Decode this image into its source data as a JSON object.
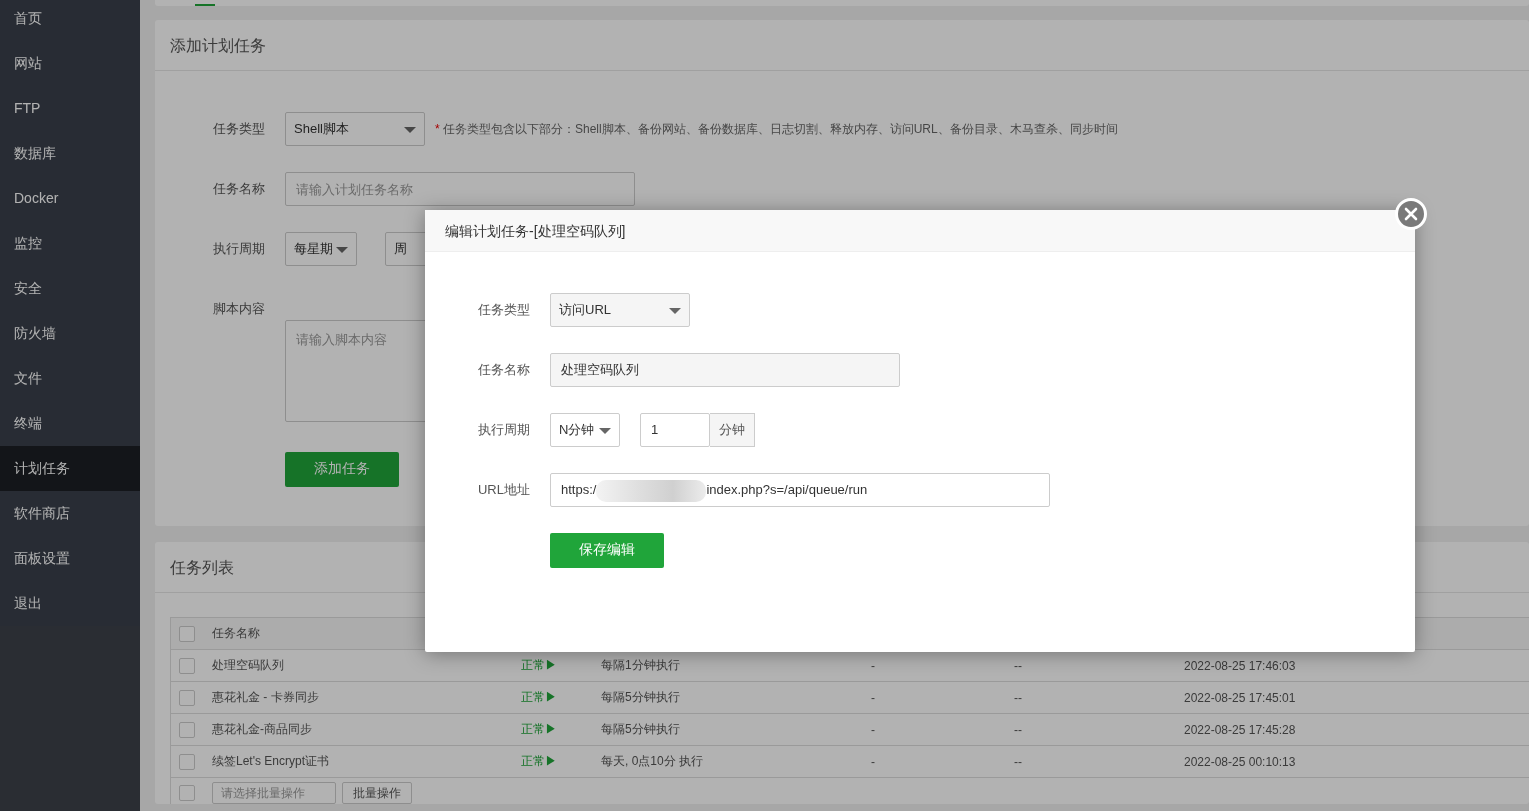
{
  "sidebar": {
    "items": [
      {
        "label": "首页",
        "selected": false
      },
      {
        "label": "网站",
        "selected": false
      },
      {
        "label": "FTP",
        "selected": false
      },
      {
        "label": "数据库",
        "selected": false
      },
      {
        "label": "Docker",
        "selected": false
      },
      {
        "label": "监控",
        "selected": false
      },
      {
        "label": "安全",
        "selected": false
      },
      {
        "label": "防火墙",
        "selected": false
      },
      {
        "label": "文件",
        "selected": false
      },
      {
        "label": "终端",
        "selected": false
      },
      {
        "label": "计划任务",
        "selected": true
      },
      {
        "label": "软件商店",
        "selected": false
      },
      {
        "label": "面板设置",
        "selected": false
      },
      {
        "label": "退出",
        "selected": false
      }
    ]
  },
  "add_task": {
    "title": "添加计划任务",
    "type_label": "任务类型",
    "type_value": "Shell脚本",
    "type_hint_mark": "*",
    "type_hint": "任务类型包含以下部分：Shell脚本、备份网站、备份数据库、日志切割、释放内存、访问URL、备份目录、木马查杀、同步时间",
    "name_label": "任务名称",
    "name_placeholder": "请输入计划任务名称",
    "period_label": "执行周期",
    "period_value": "每星期",
    "weekday_value": "周",
    "script_label": "脚本内容",
    "script_placeholder": "请输入脚本内容",
    "submit": "添加任务"
  },
  "task_list": {
    "title": "任务列表",
    "columns": [
      "任务名称"
    ],
    "header_checked": false,
    "batch_checked": false,
    "rows": [
      {
        "checked": false,
        "name": "处理空码队列",
        "status": "正常▶",
        "period": "每隔1分钟执行",
        "column_4": "-",
        "column_5": "--",
        "time": "2022-08-25 17:46:03"
      },
      {
        "checked": false,
        "name": "惠花礼金 - 卡券同步",
        "status": "正常▶",
        "period": "每隔5分钟执行",
        "column_4": "-",
        "column_5": "--",
        "time": "2022-08-25 17:45:01"
      },
      {
        "checked": false,
        "name": "惠花礼金-商品同步",
        "status": "正常▶",
        "period": "每隔5分钟执行",
        "column_4": "-",
        "column_5": "--",
        "time": "2022-08-25 17:45:28"
      },
      {
        "checked": false,
        "name": "续签Let's Encrypt证书",
        "status": "正常▶",
        "period": "每天, 0点10分 执行",
        "column_4": "-",
        "column_5": "--",
        "time": "2022-08-25 00:10:13"
      }
    ],
    "batch_placeholder": "请选择批量操作",
    "batch_button": "批量操作"
  },
  "dialog": {
    "title": "编辑计划任务-[处理空码队列]",
    "type_label": "任务类型",
    "type_value": "访问URL",
    "name_label": "任务名称",
    "name_value": "处理空码队列",
    "period_label": "执行周期",
    "period_value": "N分钟",
    "minutes_value": "1",
    "minutes_unit": "分钟",
    "url_label": "URL地址",
    "url_start": "https:/",
    "url_end": "index.php?s=/api/queue/run",
    "save": "保存编辑"
  }
}
